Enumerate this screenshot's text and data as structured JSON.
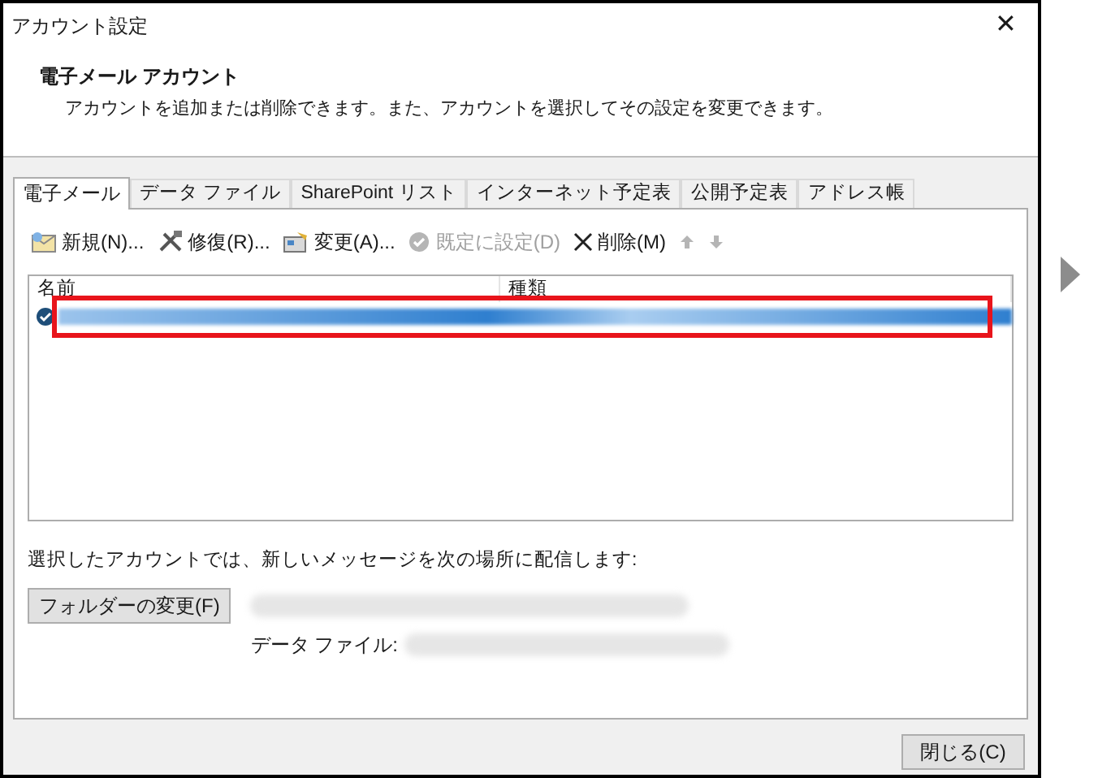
{
  "window": {
    "title": "アカウント設定",
    "close": "✕"
  },
  "header": {
    "title": "電子メール アカウント",
    "description": "アカウントを追加または削除できます。また、アカウントを選択してその設定を変更できます。"
  },
  "tabs": [
    {
      "label": "電子メール",
      "selected": true
    },
    {
      "label": "データ ファイル",
      "selected": false
    },
    {
      "label": "SharePoint リスト",
      "selected": false
    },
    {
      "label": "インターネット予定表",
      "selected": false
    },
    {
      "label": "公開予定表",
      "selected": false
    },
    {
      "label": "アドレス帳",
      "selected": false
    }
  ],
  "toolbar": [
    {
      "kind": "new",
      "label": "新規(N)...",
      "disabled": false
    },
    {
      "kind": "repair",
      "label": "修復(R)...",
      "disabled": false
    },
    {
      "kind": "change",
      "label": "変更(A)...",
      "disabled": false
    },
    {
      "kind": "default",
      "label": "既定に設定(D)",
      "disabled": true
    },
    {
      "kind": "delete",
      "label": "削除(M)",
      "disabled": false
    },
    {
      "kind": "up",
      "disabled": true
    },
    {
      "kind": "down",
      "disabled": true
    }
  ],
  "table": {
    "columns": [
      "名前",
      "種類"
    ],
    "rows": [
      {
        "selected": true,
        "default": true,
        "highlighted": true
      }
    ]
  },
  "delivery": {
    "label": "選択したアカウントでは、新しいメッセージを次の場所に配信します:",
    "button": "フォルダーの変更(F)",
    "data_file_label": "データ ファイル:"
  },
  "footer": {
    "button": "閉じる(C)"
  }
}
